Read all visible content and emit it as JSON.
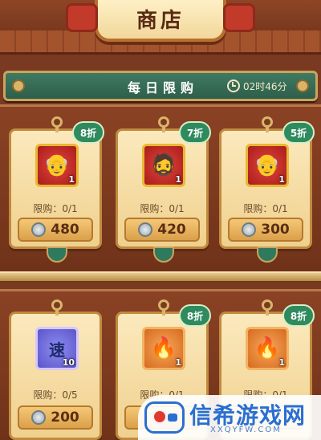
{
  "header": {
    "title": "商店"
  },
  "banner": {
    "title": "每日限购",
    "timer": "02时46分"
  },
  "items": [
    {
      "discount": "8折",
      "icon": "hero-silver-hair-portrait",
      "qty": "1",
      "limit": "限购：0/1",
      "price": "480",
      "frame": "red",
      "glyph": "👴"
    },
    {
      "discount": "7折",
      "icon": "hero-bearded-portrait",
      "qty": "1",
      "limit": "限购：0/1",
      "price": "420",
      "frame": "red",
      "glyph": "🧔"
    },
    {
      "discount": "5折",
      "icon": "hero-gray-hair-portrait",
      "qty": "1",
      "limit": "限购：0/1",
      "price": "300",
      "frame": "red",
      "glyph": "👴"
    },
    {
      "discount": "",
      "icon": "speed-ticket-icon",
      "qty": "10",
      "limit": "限购：0/5",
      "price": "200",
      "frame": "blue",
      "glyph": "速"
    },
    {
      "discount": "8折",
      "icon": "flame-feather-icon",
      "qty": "1",
      "limit": "限购：0/1",
      "price": "",
      "frame": "orange",
      "glyph": "🔥"
    },
    {
      "discount": "8折",
      "icon": "flame-feather-icon",
      "qty": "1",
      "limit": "限购：0/1",
      "price": "",
      "frame": "orange",
      "glyph": "🔥"
    }
  ],
  "currency_icon": "silver-coin-icon",
  "watermark": {
    "name": "信希游戏网",
    "url": "XXQYFW.COM"
  },
  "colors": {
    "banner": "#2e5e4a",
    "discount_badge": "#2f8a5e",
    "price_button": "#dba04a",
    "shelf": "#7a3a22"
  }
}
